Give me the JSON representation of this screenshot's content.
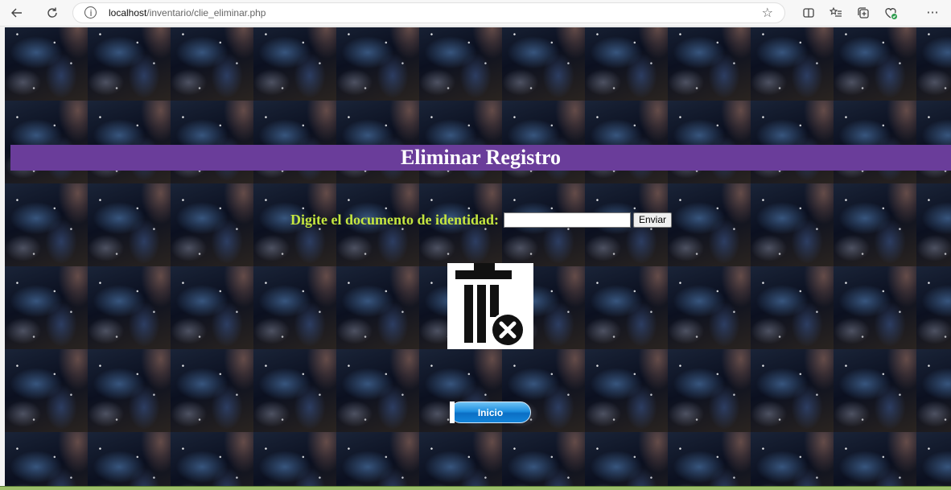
{
  "browser": {
    "url_host": "localhost",
    "url_path": "/inventario/clie_eliminar.php",
    "icons": [
      "back-arrow-icon",
      "refresh-icon",
      "info-icon",
      "favorite-star-icon",
      "split-screen-icon",
      "favorites-icon",
      "collections-icon",
      "browser-essentials-icon",
      "more-icon"
    ]
  },
  "page": {
    "title": "Eliminar Registro",
    "form": {
      "label": "Digite el documento de identidad:",
      "input_value": "",
      "submit_label": "Enviar"
    },
    "image_icon": "delete-trash-icon",
    "home_button_label": "Inicio",
    "colors": {
      "banner": "#6a3d9a",
      "label_text": "#c5e63f",
      "home_button": "#1e8fe0"
    }
  }
}
